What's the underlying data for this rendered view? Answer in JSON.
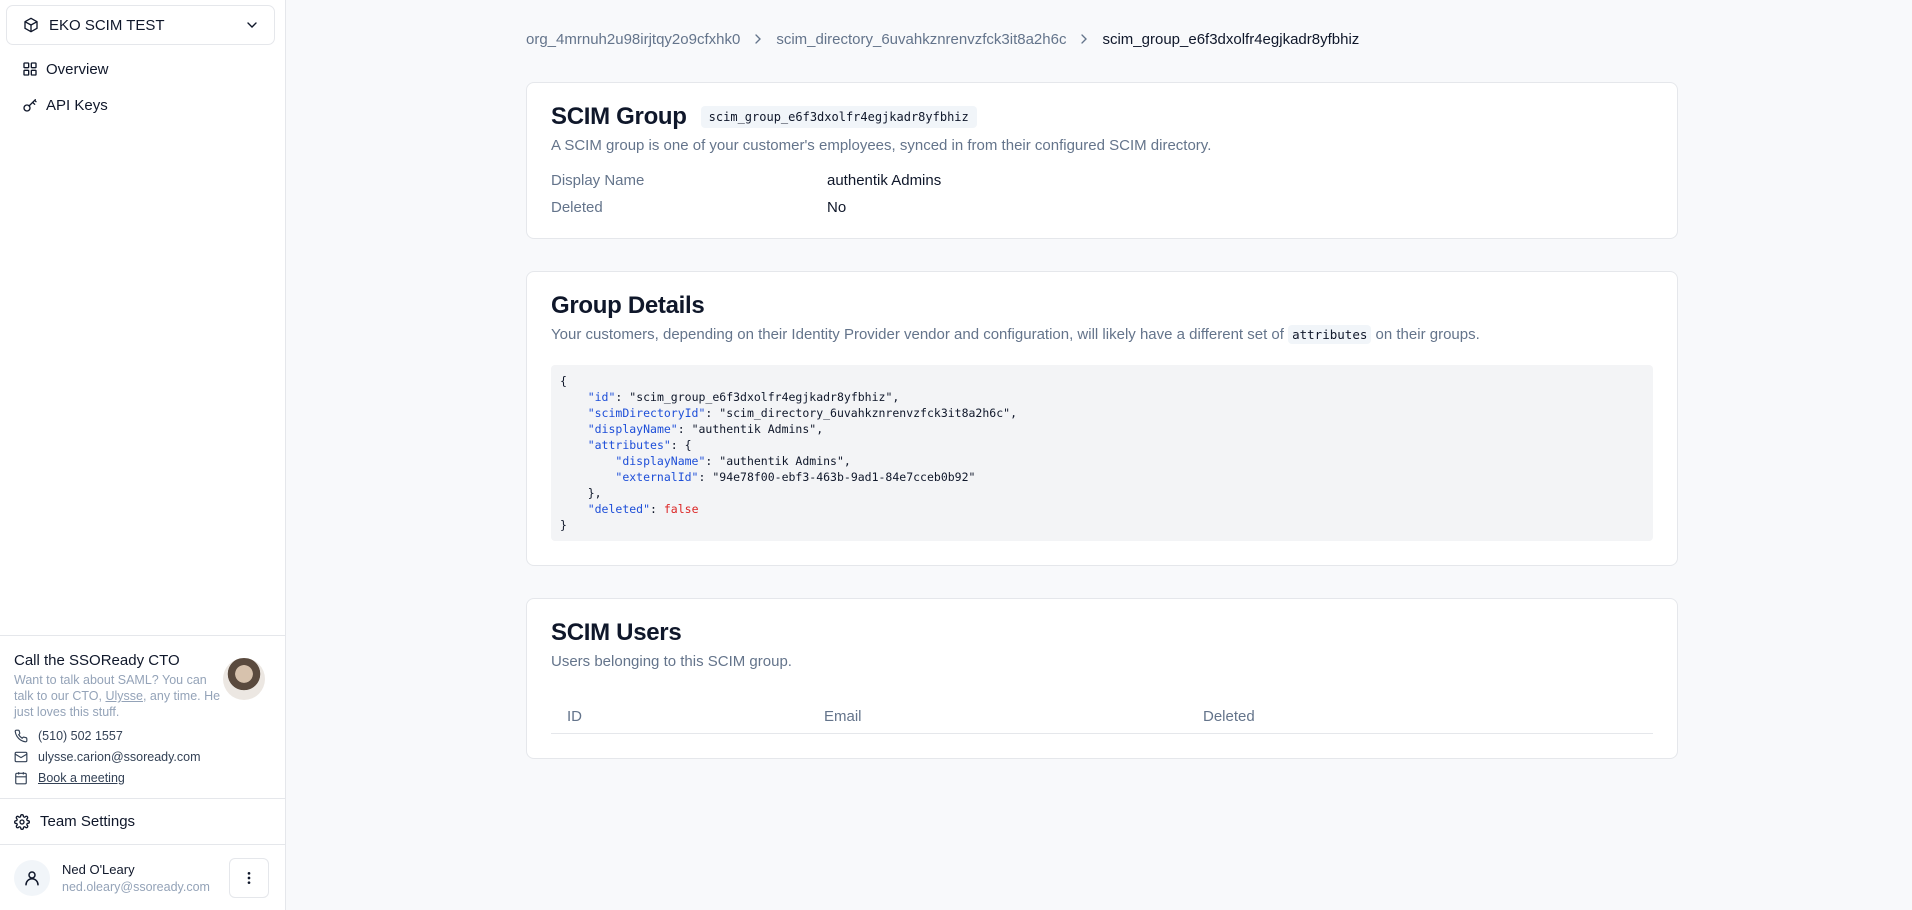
{
  "sidebar": {
    "org_name": "EKO SCIM TEST",
    "nav": [
      {
        "label": "Overview",
        "icon": "grid-icon"
      },
      {
        "label": "API Keys",
        "icon": "key-icon"
      }
    ],
    "cto": {
      "title": "Call the SSOReady CTO",
      "desc_before": "Want to talk about SAML? You can talk to our CTO, ",
      "desc_link": "Ulysse",
      "desc_after": ", any time. He just loves this stuff.",
      "phone": "(510) 502 1557",
      "email": "ulysse.carion@ssoready.com",
      "meeting": "Book a meeting"
    },
    "team_settings": "Team Settings",
    "user": {
      "name": "Ned O'Leary",
      "email": "ned.oleary@ssoready.com"
    }
  },
  "breadcrumb": {
    "org": "org_4mrnuh2u98irjtqy2o9cfxhk0",
    "directory": "scim_directory_6uvahkznrenvzfck3it8a2h6c",
    "group": "scim_group_e6f3dxolfr4egjkadr8yfbhiz"
  },
  "group_card": {
    "title": "SCIM Group",
    "id_badge": "scim_group_e6f3dxolfr4egjkadr8yfbhiz",
    "desc": "A SCIM group is one of your customer's employees, synced in from their configured SCIM directory.",
    "display_name_label": "Display Name",
    "display_name_value": "authentik Admins",
    "deleted_label": "Deleted",
    "deleted_value": "No"
  },
  "details_card": {
    "title": "Group Details",
    "desc_before": "Your customers, depending on their Identity Provider vendor and configuration, will likely have a different set of ",
    "desc_code": "attributes",
    "desc_after": " on their groups.",
    "json": {
      "id": "scim_group_e6f3dxolfr4egjkadr8yfbhiz",
      "scimDirectoryId": "scim_directory_6uvahkznrenvzfck3it8a2h6c",
      "displayName": "authentik Admins",
      "attr_displayName": "authentik Admins",
      "attr_externalId": "94e78f00-ebf3-463b-9ad1-84e7cceb0b92",
      "deleted": "false"
    }
  },
  "users_card": {
    "title": "SCIM Users",
    "desc": "Users belonging to this SCIM group.",
    "columns": [
      "ID",
      "Email",
      "Deleted"
    ]
  }
}
